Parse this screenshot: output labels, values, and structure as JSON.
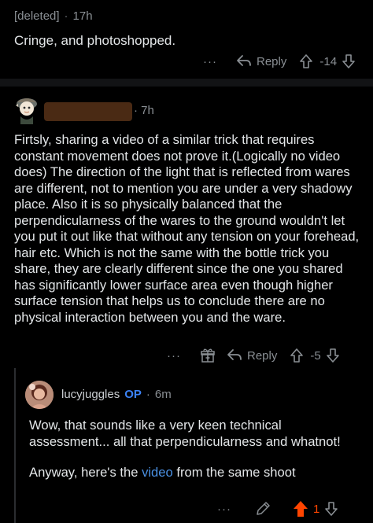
{
  "comment1": {
    "author": "[deleted]",
    "separator": "·",
    "time": "17h",
    "text": "Cringe, and photoshopped.",
    "more": "···",
    "reply": "Reply",
    "score": "-14"
  },
  "comment2": {
    "time": "7h",
    "separator": "·",
    "text": "Firtsly, sharing a video of a similar trick that requires constant movement does not prove it.(Logically no video does) The direction of the light that is reflected from wares are different, not to mention you are under a very shadowy place. Also it is so physically balanced that the perpendicularness of the wares to the ground wouldn't let you put it out like that without any tension on your forehead, hair etc. Which is not the same with the bottle trick you share, they are clearly different since the one you shared has significantly lower surface area even though higher surface tension that helps us to conclude there are no physical interaction between you and the ware.",
    "more": "···",
    "reply": "Reply",
    "score": "-5"
  },
  "comment3": {
    "author": "lucyjuggles",
    "op_badge": "OP",
    "separator": "·",
    "time": "6m",
    "paragraph1": "Wow, that sounds like a very keen technical assessment... all that perpendicularness and whatnot!",
    "paragraph2_before": "Anyway, here's the ",
    "paragraph2_link": "video",
    "paragraph2_after": " from the same shoot",
    "more": "···",
    "score": "1"
  },
  "colors": {
    "background": "#000000",
    "text": "#e3e6e8",
    "muted": "#8a8f94",
    "op_blue": "#3b82f6",
    "link_blue": "#4a90e2",
    "upvote_orange": "#ff4500"
  },
  "icons": [
    "reply-arrow-icon",
    "upvote-arrow-icon",
    "downvote-arrow-icon",
    "award-gift-icon",
    "edit-pencil-icon",
    "more-dots-icon"
  ]
}
